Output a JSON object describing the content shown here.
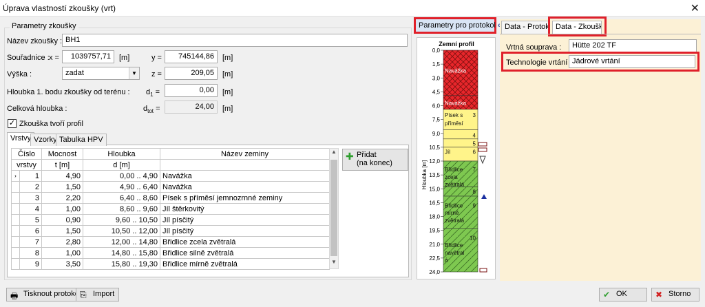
{
  "window": {
    "title": "Úprava vlastností zkoušky (vrt)"
  },
  "params": {
    "group_title": "Parametry zkoušky",
    "name_label": "Název zkoušky :",
    "name_value": "BH1",
    "coords_label": "Souřadnice :",
    "x_label": "x =",
    "x_value": "1039757,71",
    "x_unit": "[m]",
    "y_label": "y =",
    "y_value": "745144,86",
    "y_unit": "[m]",
    "height_label": "Výška :",
    "height_mode": "zadat",
    "z_label": "z =",
    "z_value": "209,05",
    "z_unit": "[m]",
    "d1_label": "Hloubka 1. bodu zkoušky od terénu :",
    "d1_symbol": "d",
    "d1_sub": "1",
    "d1_eq": " =",
    "d1_value": "0,00",
    "d1_unit": "[m]",
    "dtot_label": "Celková hloubka :",
    "dtot_symbol": "d",
    "dtot_sub": "tot",
    "dtot_eq": " =",
    "dtot_value": "24,00",
    "dtot_unit": "[m]",
    "profile_check_label": "Zkouška tvoří profil",
    "profile_checked": "✓"
  },
  "tabs": [
    "Vrstvy",
    "Vzorky",
    "Tabulka HPV"
  ],
  "table": {
    "headers": [
      [
        "Číslo",
        "vrstvy"
      ],
      [
        "Mocnost",
        "t [m]"
      ],
      [
        "Hloubka",
        "d [m]"
      ],
      [
        "Název zeminy",
        ""
      ]
    ],
    "rows": [
      {
        "no": "1",
        "t": "4,90",
        "d": "0,00 .. 4,90",
        "name": "Navážka",
        "marker": "›"
      },
      {
        "no": "2",
        "t": "1,50",
        "d": "4,90 .. 6,40",
        "name": "Navážka",
        "marker": ""
      },
      {
        "no": "3",
        "t": "2,20",
        "d": "6,40 .. 8,60",
        "name": "Písek s příměsí jemnozrnné zeminy",
        "marker": ""
      },
      {
        "no": "4",
        "t": "1,00",
        "d": "8,60 .. 9,60",
        "name": "Jíl štěrkovitý",
        "marker": ""
      },
      {
        "no": "5",
        "t": "0,90",
        "d": "9,60 .. 10,50",
        "name": "Jíl písčitý",
        "marker": ""
      },
      {
        "no": "6",
        "t": "1,50",
        "d": "10,50 .. 12,00",
        "name": "Jíl písčitý",
        "marker": ""
      },
      {
        "no": "7",
        "t": "2,80",
        "d": "12,00 .. 14,80",
        "name": "Břidlice zcela zvětralá",
        "marker": ""
      },
      {
        "no": "8",
        "t": "1,00",
        "d": "14,80 .. 15,80",
        "name": "Břidlice silně zvětralá",
        "marker": ""
      },
      {
        "no": "9",
        "t": "3,50",
        "d": "15,80 .. 19,30",
        "name": "Břidlice mírně zvětralá",
        "marker": ""
      }
    ]
  },
  "add_button": {
    "line1": "Přidat",
    "line2": "(na konec)"
  },
  "profile": {
    "header": "Parametry pro protokol",
    "chevron": "«",
    "title": "Zemní profil",
    "axis_label": "Hloubka [m]",
    "ticks": [
      "0,0",
      "1,5",
      "3,0",
      "4,5",
      "6,0",
      "7,5",
      "9,0",
      "10,5",
      "12,0",
      "13,5",
      "15,0",
      "16,5",
      "18,0",
      "19,5",
      "21,0",
      "22,5",
      "24,0"
    ],
    "layer_labels": [
      {
        "text": "Navážka",
        "num": "",
        "depth": 2.2
      },
      {
        "text": "Navážka",
        "num": "",
        "depth": 5.7
      },
      {
        "text": "Písek s",
        "num": "3",
        "depth": 7.0
      },
      {
        "text": "příměsí",
        "num": "",
        "depth": 7.9
      },
      {
        "text": "",
        "num": "4",
        "depth": 9.2
      },
      {
        "text": "",
        "num": "5",
        "depth": 10.1
      },
      {
        "text": "Jíl",
        "num": "6",
        "depth": 11.0
      },
      {
        "text": "Břidlice",
        "num": "7",
        "depth": 12.9
      },
      {
        "text": "zcela",
        "num": "",
        "depth": 13.7
      },
      {
        "text": "zvětralá",
        "num": "",
        "depth": 14.5
      },
      {
        "text": "",
        "num": "8",
        "depth": 15.3
      },
      {
        "text": "Břidlice",
        "num": "9",
        "depth": 16.8
      },
      {
        "text": "mírně",
        "num": "",
        "depth": 17.6
      },
      {
        "text": "zvětralá",
        "num": "",
        "depth": 18.4
      },
      {
        "text": "",
        "num": "10",
        "depth": 20.3
      },
      {
        "text": "Břidlice",
        "num": "",
        "depth": 21.1
      },
      {
        "text": "navětral",
        "num": "",
        "depth": 21.9
      },
      {
        "text": "á",
        "num": "",
        "depth": 22.7
      }
    ]
  },
  "right": {
    "tab1": "Data - Protokol",
    "tab2": "Data - Zkouška",
    "rig_label": "Vrtná souprava :",
    "rig_value": "Hütte 202 TF",
    "tech_label": "Technologie vrtání :",
    "tech_value": "Jádrové vrtání"
  },
  "bottom": {
    "print": "Tisknout protokol",
    "import": "Import",
    "ok": "OK",
    "cancel": "Storno"
  },
  "colors": {
    "highlight": "#e0202a",
    "fill_red": "#e8262b",
    "fill_yellow": "#fff48a",
    "fill_green": "#7ec850",
    "panel_bg": "#fcf1d6"
  }
}
